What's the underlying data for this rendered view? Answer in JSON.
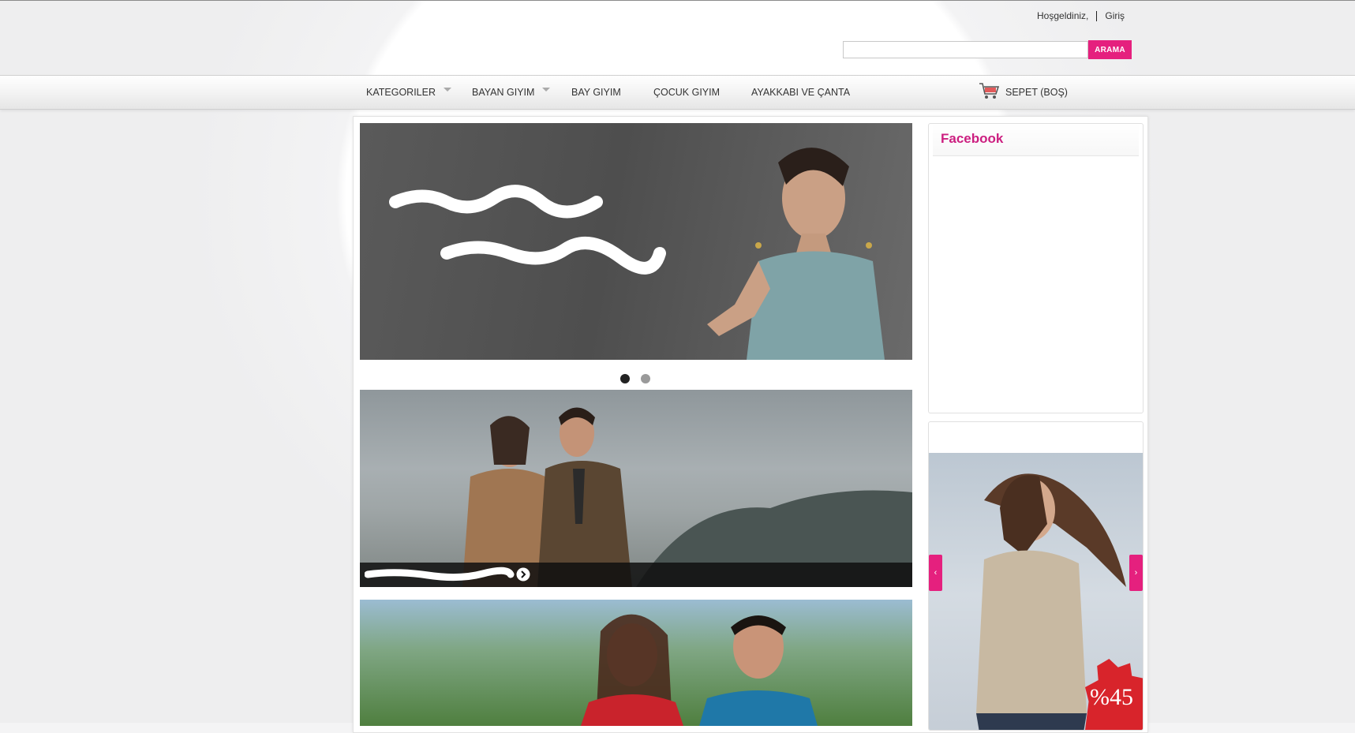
{
  "header": {
    "welcome_text": "Hoşgeldiniz,",
    "login_link": "Giriş",
    "search": {
      "value": "",
      "button_label": "ARAMA"
    }
  },
  "nav": {
    "items": [
      {
        "label": "KATEGORILER",
        "has_dropdown": true
      },
      {
        "label": "BAYAN GIYIM",
        "has_dropdown": true
      },
      {
        "label": "BAY GIYIM",
        "has_dropdown": false
      },
      {
        "label": "ÇOCUK GIYIM",
        "has_dropdown": false
      },
      {
        "label": "AYAKKABI VE ÇANTA",
        "has_dropdown": false
      }
    ],
    "cart_label": "SEPET (BOŞ)"
  },
  "slider": {
    "dot_count": 2,
    "active_dot": 1
  },
  "sidebar": {
    "facebook_title": "Facebook",
    "promo_badge": "%45"
  },
  "colors": {
    "accent": "#e5207e",
    "facebook_title": "#cc1f80",
    "badge": "#d8242b"
  },
  "icons": {
    "cart": "shopping-cart-icon",
    "caption_arrow": "arrow-right-circle-icon",
    "promo_prev": "chevron-left-icon",
    "promo_next": "chevron-right-icon"
  }
}
